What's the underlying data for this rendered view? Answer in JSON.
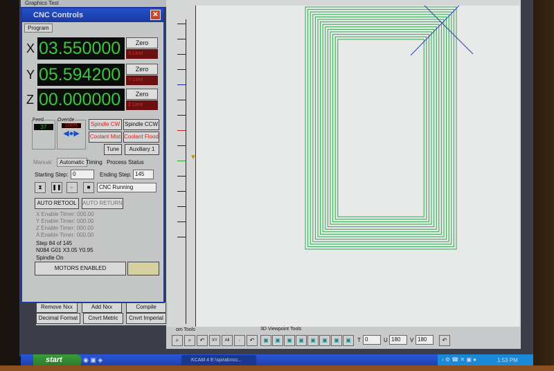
{
  "graphics_window": {
    "title": "Graphics Test"
  },
  "cnc": {
    "title": "CNC Controls",
    "tab": "Program",
    "axes": [
      {
        "label": "X",
        "value": "03.550000",
        "zero": "Zero",
        "limit": "X Limit"
      },
      {
        "label": "Y",
        "value": "05.594200",
        "zero": "Zero",
        "limit": "Y Limit"
      },
      {
        "label": "Z",
        "value": "00.000000",
        "zero": "Zero",
        "limit": "Z Limit"
      }
    ],
    "feed_label": "Feed",
    "feed_value": "37",
    "override_label": "Overide",
    "override_value": "100%",
    "buttons": {
      "spindle_cw": "Spindle CW",
      "spindle_ccw": "Spindle CCW",
      "coolant_mist": "Coolant Mist",
      "coolant_flood": "Coolant Flood",
      "tune": "Tune",
      "aux1": "Auxiliary 1",
      "auto_retool": "AUTO RETOOL",
      "auto_return": "AUTO RETURN",
      "motors": "MOTORS ENABLED"
    },
    "tabs": [
      "Manual",
      "Automatic",
      "Timing",
      "Process Status"
    ],
    "starting_step_label": "Starting Step:",
    "starting_step": "0",
    "ending_step_label": "Ending Step:",
    "ending_step": "145",
    "status": "CNC Running",
    "timers": [
      "X Enable Timer: 000.00",
      "Y Enable Timer: 000.00",
      "Z Enable Timer: 000.00",
      "A Enable Timer: 000.00"
    ],
    "step_text": "Step 84 of 145",
    "gcode": "N084 G01 X3.05 Y0.95",
    "spindle_status": "Spindle On"
  },
  "editor_buttons": [
    "Remove Nxx",
    "Add Nxx",
    "Compile",
    "Decimal Format",
    "Cnvrt Metric",
    "Cnvrt Imperial"
  ],
  "toolbars": {
    "zoom_label": "om Tools",
    "viewpoint_label": "3D Viewpoint Tools",
    "t_label": "T",
    "t_value": "0",
    "u_label": "U",
    "u_value": "180",
    "v_label": "V",
    "v_value": "180",
    "zoom_buttons": [
      "XY",
      "All"
    ]
  },
  "taskbar": {
    "start": "start",
    "task": "KCAM 4  E:\\spiralcncc...",
    "clock": "1:53 PM"
  },
  "colors": {
    "spiral": "#2aa84a",
    "dro": "#39c839",
    "titlebar": "#2450c8"
  }
}
